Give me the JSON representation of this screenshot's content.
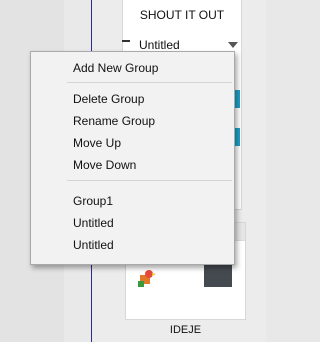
{
  "background_card": {
    "title": "SHOUT IT OUT",
    "group_select_value": "Untitled",
    "bottom_label": "IDEJE"
  },
  "context_menu": {
    "items": [
      {
        "label": "Add New Group"
      },
      {
        "label": "Delete Group"
      },
      {
        "label": "Rename Group"
      },
      {
        "label": "Move Up"
      },
      {
        "label": "Move Down"
      },
      {
        "label": "Group1"
      },
      {
        "label": "Untitled"
      },
      {
        "label": "Untitled"
      }
    ]
  },
  "colors": {
    "accent_blue": "#1f9fc6",
    "divider_blue": "#2c2c8c",
    "menu_bg": "#f2f2f2"
  }
}
